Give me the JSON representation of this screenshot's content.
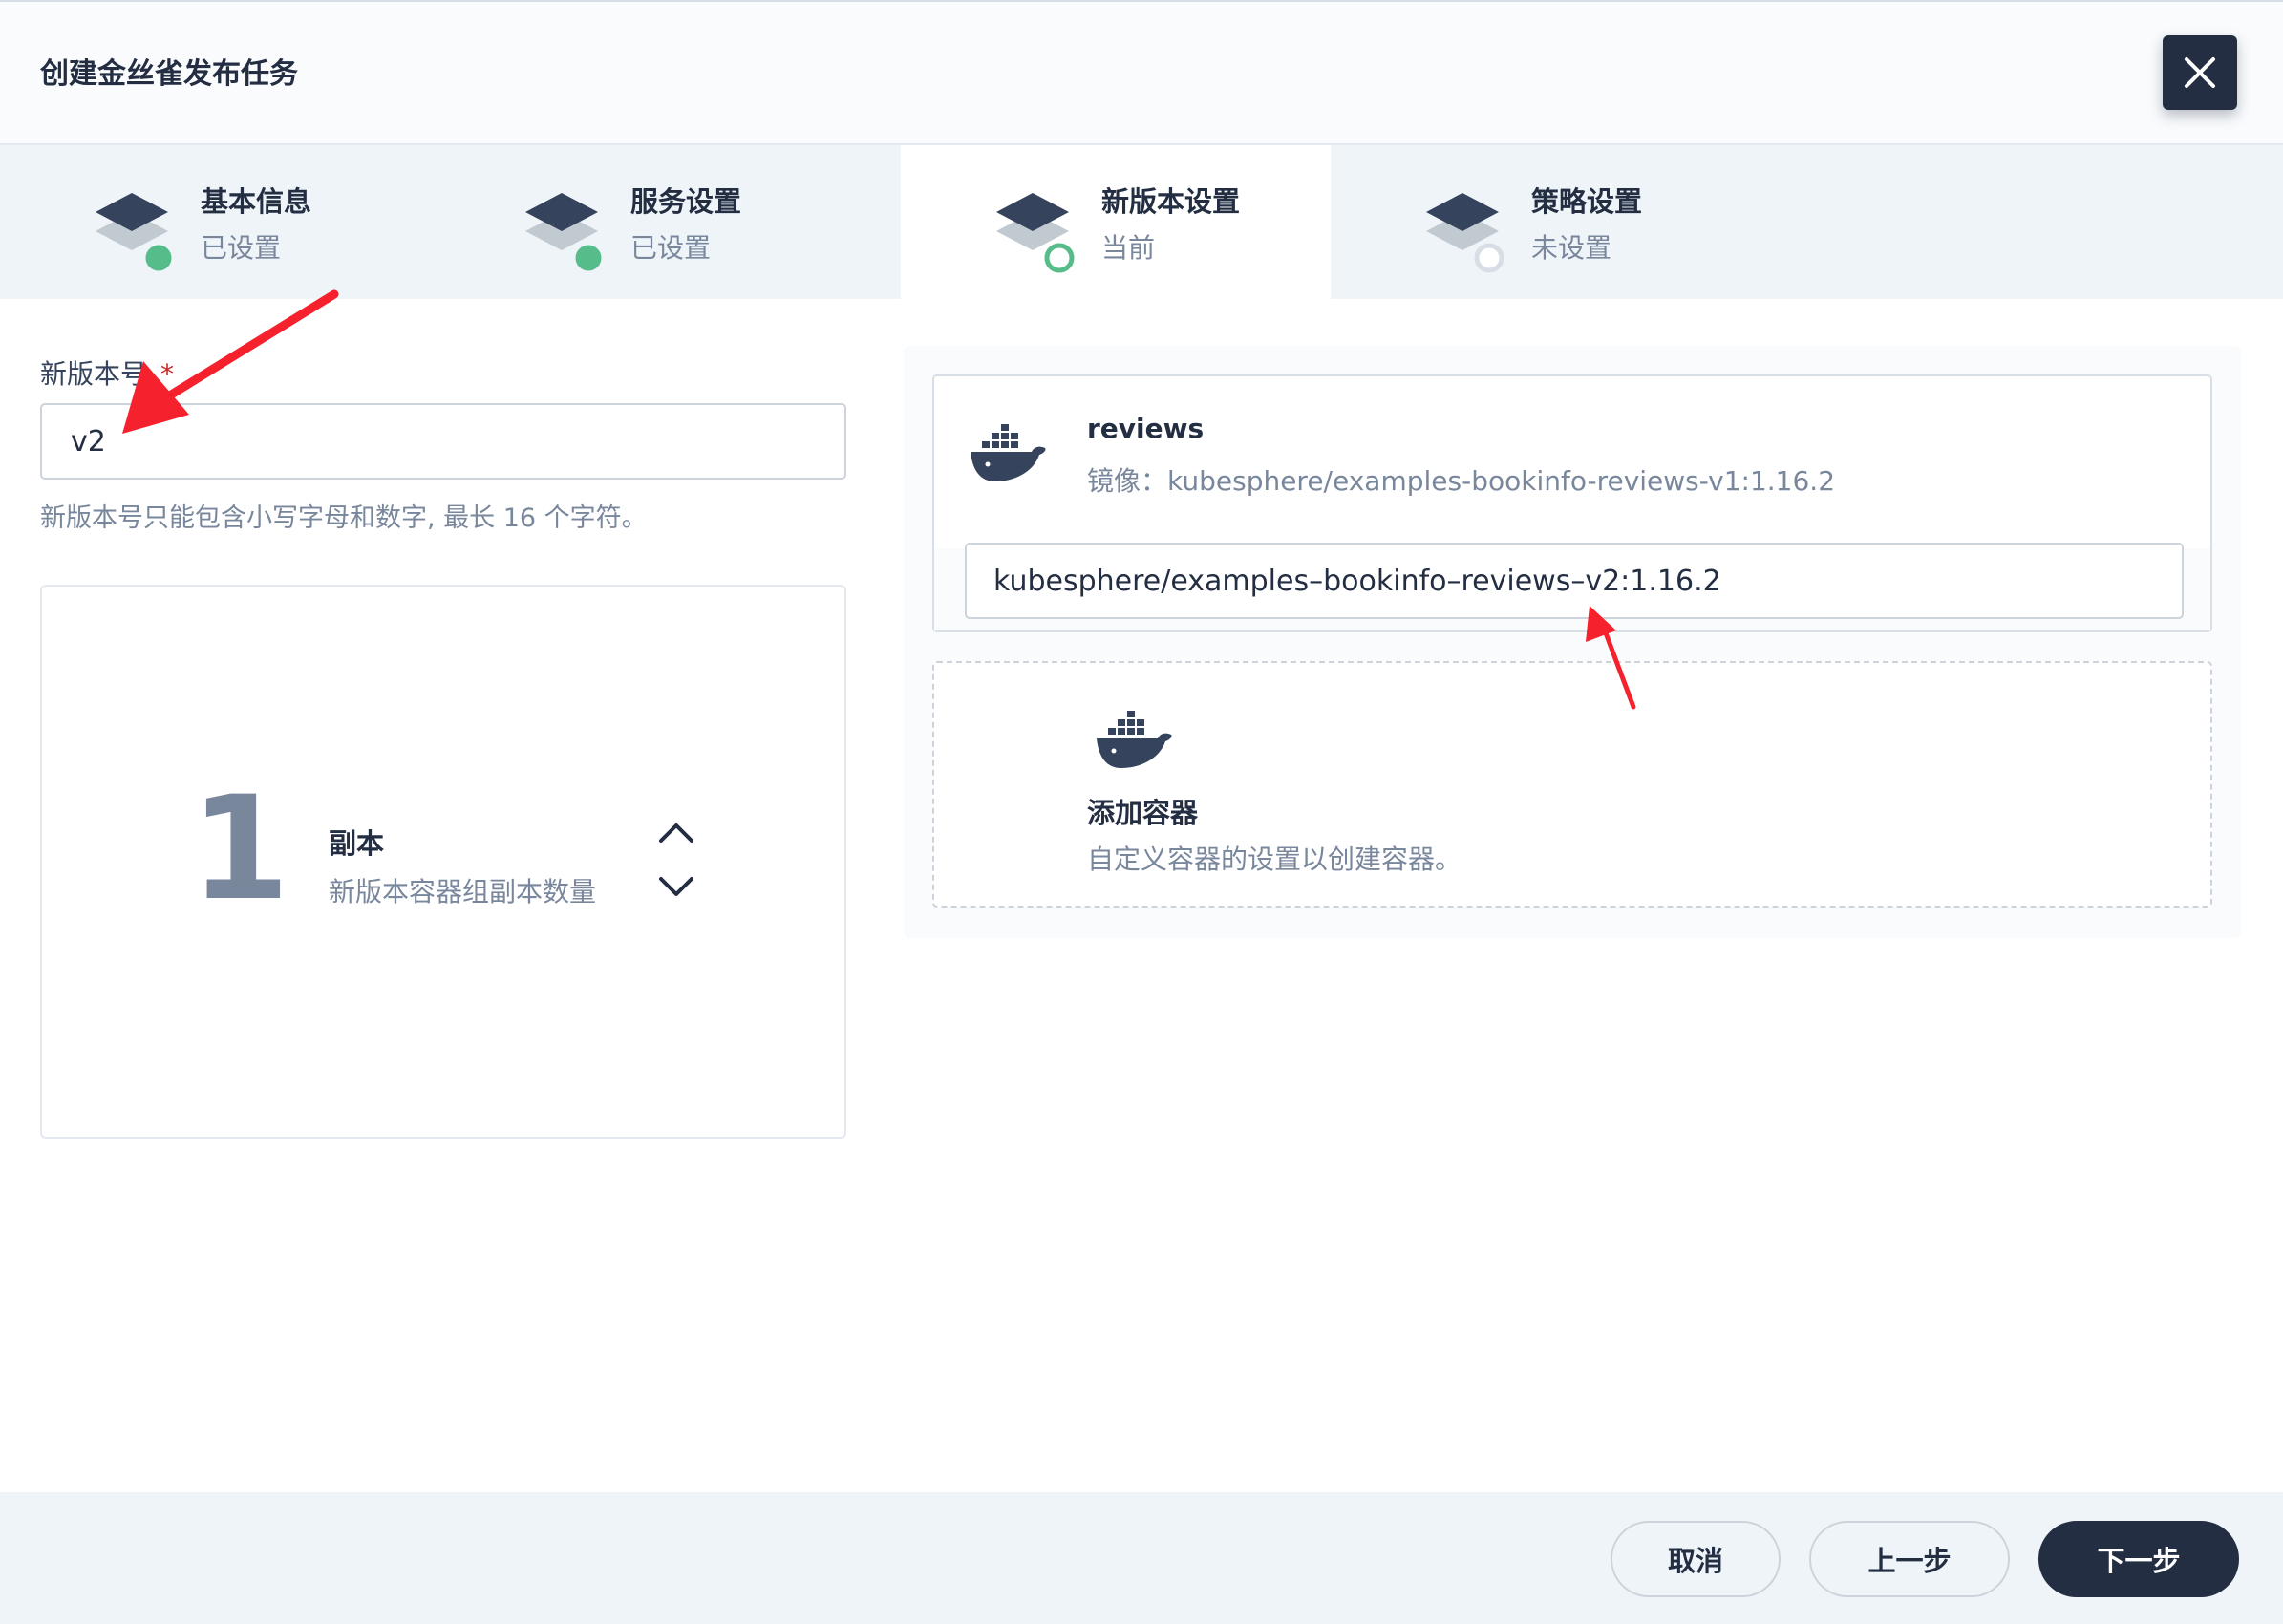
{
  "dialog": {
    "title": "创建金丝雀发布任务",
    "close_icon": "close-icon"
  },
  "steps": [
    {
      "label": "基本信息",
      "status": "已设置",
      "state": "done"
    },
    {
      "label": "服务设置",
      "status": "已设置",
      "state": "done"
    },
    {
      "label": "新版本设置",
      "status": "当前",
      "state": "current"
    },
    {
      "label": "策略设置",
      "status": "未设置",
      "state": "pending"
    }
  ],
  "form": {
    "version_label": "新版本号",
    "required_mark": "*",
    "version_value": "v2",
    "version_hint": "新版本号只能包含小写字母和数字, 最长 16 个字符。"
  },
  "replicas": {
    "count": "1",
    "title": "副本",
    "description": "新版本容器组副本数量"
  },
  "container": {
    "name": "reviews",
    "image_line": "镜像：kubesphere/examples-bookinfo-reviews-v1:1.16.2",
    "new_image_value": "kubesphere/examples–bookinfo–reviews–v2:1.16.2"
  },
  "add_container": {
    "title": "添加容器",
    "description": "自定义容器的设置以创建容器。"
  },
  "footer": {
    "cancel": "取消",
    "prev": "上一步",
    "next": "下一步"
  },
  "colors": {
    "primary": "#242e42",
    "success": "#55bc8a",
    "muted": "#79879c",
    "annotation": "#f5222d"
  }
}
